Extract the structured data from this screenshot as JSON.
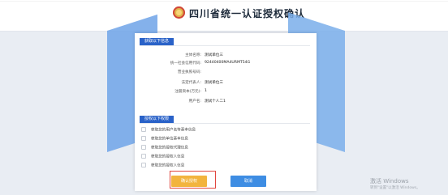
{
  "header": {
    "title": "四川省统一认证授权确认"
  },
  "sections": {
    "subject_title": "获取以下信息",
    "permissions_title": "授权以下权限"
  },
  "info_rows": [
    {
      "label": "主体名称:",
      "value": "测试单位三"
    },
    {
      "label": "统一社会信用代码:",
      "value": "92440400MA4URMT54G"
    },
    {
      "label": "营业执照号码:",
      "value": ""
    },
    {
      "label": "法定代表人:",
      "value": "测试单位三"
    },
    {
      "label": "注册资本(万元):",
      "value": "1"
    },
    {
      "label": "用户名:",
      "value": "测试个人二1"
    }
  ],
  "permissions": [
    "获取您的用户名等基本信息",
    "获取您的单位基本信息",
    "获取您的授权代理信息",
    "获取您的授权人信息",
    "获取您的授权人信息"
  ],
  "buttons": {
    "confirm": "确认授权",
    "cancel": "取消"
  },
  "watermark": {
    "line1": "激活 Windows",
    "line2": "转到\"设置\"以激活 Windows。"
  },
  "colors": {
    "accent": "#2a62c8",
    "confirm": "#f2b43e",
    "cancel": "#3e8de3",
    "highlight": "#e1463f"
  }
}
